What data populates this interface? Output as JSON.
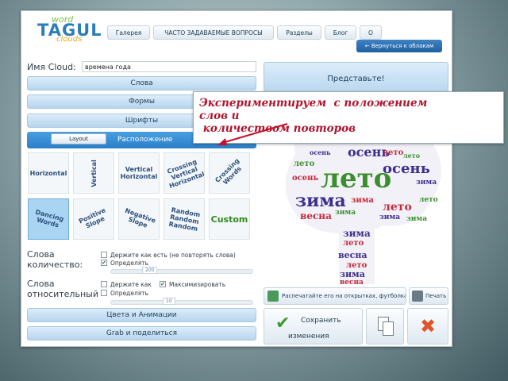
{
  "logo": {
    "line1": "word",
    "line2": "TAGUL",
    "line3": "clouds"
  },
  "nav": [
    {
      "label": "Галерея"
    },
    {
      "label": "ЧАСТО ЗАДАВАЕМЫЕ ВОПРОСЫ"
    },
    {
      "label": "Разделы"
    },
    {
      "label": "Блог"
    },
    {
      "label": "О"
    }
  ],
  "back_button": "← Вернуться к облакам",
  "name": {
    "label": "Имя Cloud:",
    "value": "времена года"
  },
  "sections": {
    "words": "Слова",
    "shapes": "Формы",
    "fonts": "Шрифты",
    "layout_tab": "Layout",
    "layout": "Расположение",
    "colors": "Цвета и Анимации",
    "share": "Grab и поделиться"
  },
  "layout_tiles": [
    {
      "text": "Horizontal"
    },
    {
      "text": "Vertical"
    },
    {
      "text": "Vertical\nHorizontal"
    },
    {
      "text": "Crossing\nVertical\nHorizontal"
    },
    {
      "text": "Crossing\nWords"
    },
    {
      "text": "Dancing\nWords",
      "selected": true
    },
    {
      "text": "Positive\nSlope"
    },
    {
      "text": "Negative\nSlope"
    },
    {
      "text": "Random\nRandom\nRandom"
    },
    {
      "text": "Custom"
    }
  ],
  "word_count": {
    "title": "Слова\nколичество:",
    "opt1": "Держите как есть (не повторять слова)",
    "opt2": "Определять",
    "opt1_checked": false,
    "opt2_checked": true,
    "slider_value": "200"
  },
  "word_relative": {
    "title": "Слова\nотносительный",
    "opt1": "Держите как",
    "opt2": "Максимизировать",
    "opt3": "Определять",
    "opt1_checked": false,
    "opt2_checked": true,
    "opt3_checked": false,
    "slider_value": "10"
  },
  "imagine": "Представьте!",
  "print_button": "Распечатайте его на открытках, футболках",
  "print_small": "Печать",
  "save": {
    "line1": "Сохранить",
    "line2": "изменения"
  },
  "cloud_words": [
    "лето",
    "осень",
    "зима",
    "весна"
  ],
  "colors": {
    "accent": "#2a7fc8",
    "cloud_purple": "#3e2f8c",
    "cloud_green": "#3a8f2d",
    "cloud_red": "#c42a3c",
    "annotation": "#b1122c"
  },
  "annotation": "Экспериментируем  с положением\nслов и\n количеством повторов"
}
